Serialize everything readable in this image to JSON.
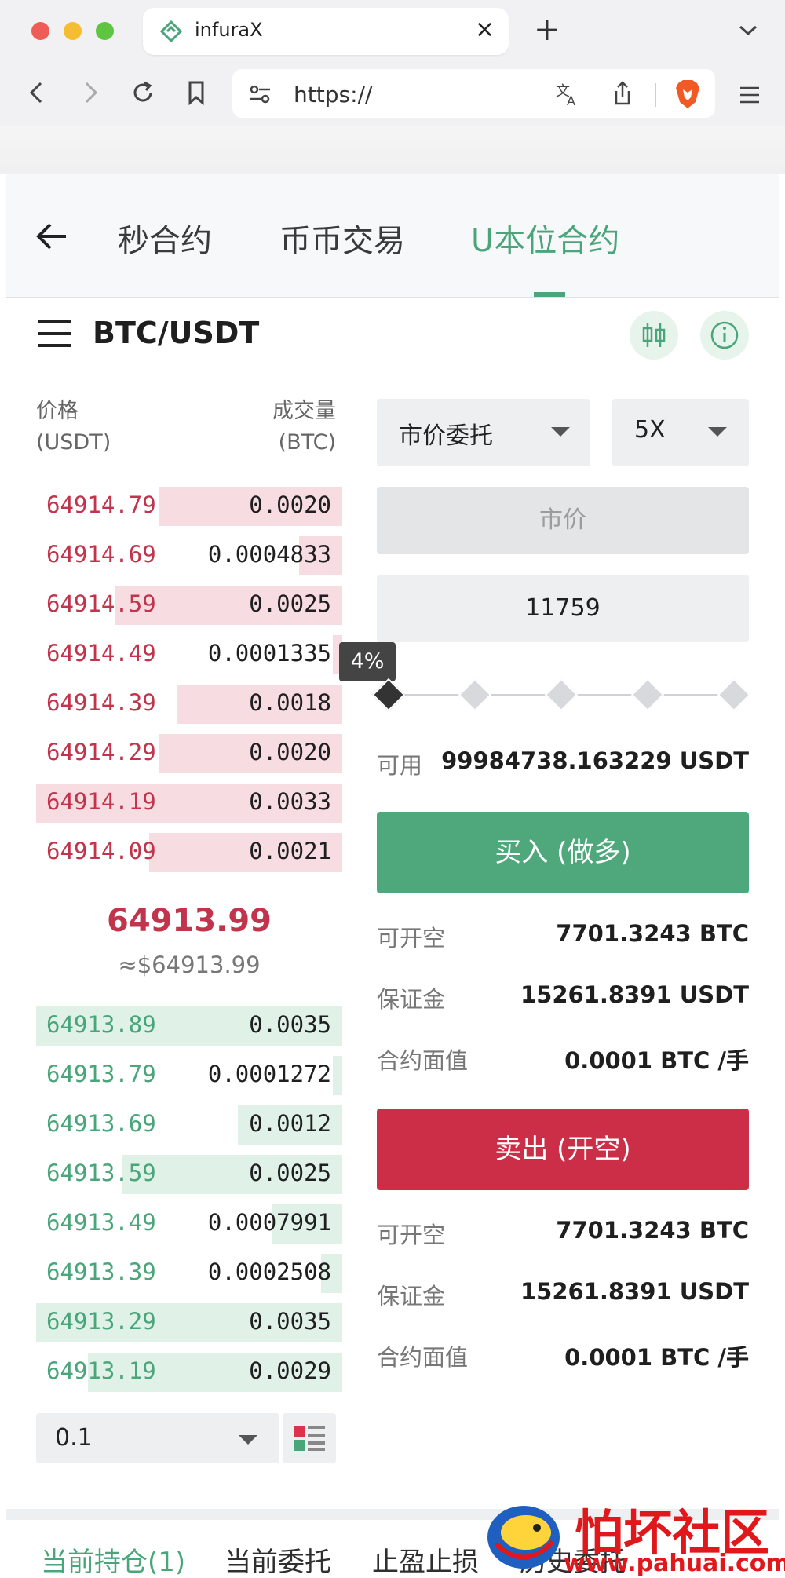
{
  "browser": {
    "tab_title": "infuraX",
    "url": "https://"
  },
  "nav": {
    "tabs": [
      "秒合约",
      "币币交易",
      "U本位合约"
    ],
    "active_tab": "U本位合约"
  },
  "symbol": "BTC/USDT",
  "orderbook": {
    "price_header": "价格",
    "price_unit": "(USDT)",
    "qty_header": "成交量",
    "qty_unit": "(BTC)",
    "asks": [
      {
        "price": "64914.79",
        "qty": "0.0020",
        "depth": 0.6
      },
      {
        "price": "64914.69",
        "qty": "0.0004833",
        "depth": 0.14
      },
      {
        "price": "64914.59",
        "qty": "0.0025",
        "depth": 0.74
      },
      {
        "price": "64914.49",
        "qty": "0.0001335",
        "depth": 0.03
      },
      {
        "price": "64914.39",
        "qty": "0.0018",
        "depth": 0.54
      },
      {
        "price": "64914.29",
        "qty": "0.0020",
        "depth": 0.6
      },
      {
        "price": "64914.19",
        "qty": "0.0033",
        "depth": 1.0
      },
      {
        "price": "64914.09",
        "qty": "0.0021",
        "depth": 0.63
      }
    ],
    "mid_price": "64913.99",
    "mid_usd": "≈$64913.99",
    "bids": [
      {
        "price": "64913.89",
        "qty": "0.0035",
        "depth": 1.0
      },
      {
        "price": "64913.79",
        "qty": "0.0001272",
        "depth": 0.03
      },
      {
        "price": "64913.69",
        "qty": "0.0012",
        "depth": 0.34
      },
      {
        "price": "64913.59",
        "qty": "0.0025",
        "depth": 0.72
      },
      {
        "price": "64913.49",
        "qty": "0.0007991",
        "depth": 0.23
      },
      {
        "price": "64913.39",
        "qty": "0.0002508",
        "depth": 0.07
      },
      {
        "price": "64913.29",
        "qty": "0.0035",
        "depth": 1.0
      },
      {
        "price": "64913.19",
        "qty": "0.0029",
        "depth": 0.83
      }
    ],
    "depth_value": "0.1"
  },
  "form": {
    "order_type": "市价委托",
    "leverage": "5X",
    "price_placeholder": "市价",
    "amount": "11759",
    "slider_label": "4%",
    "slider_percent": 4,
    "available_label": "可用",
    "available_value": "99984738.163229 USDT",
    "buy_button": "买入 (做多)",
    "buy_info": [
      {
        "label": "可开空",
        "value": "7701.3243 BTC"
      },
      {
        "label": "保证金",
        "value": "15261.8391 USDT"
      },
      {
        "label": "合约面值",
        "value": "0.0001 BTC /手"
      }
    ],
    "sell_button": "卖出 (开空)",
    "sell_info": [
      {
        "label": "可开空",
        "value": "7701.3243 BTC"
      },
      {
        "label": "保证金",
        "value": "15261.8391 USDT"
      },
      {
        "label": "合约面值",
        "value": "0.0001 BTC /手"
      }
    ]
  },
  "bottom_tabs": [
    "当前持仓(1)",
    "当前委托",
    "止盈止损",
    "历史委托"
  ],
  "watermark": {
    "text": "怕坏社区",
    "url": "www.pahuai.com"
  },
  "colors": {
    "accent_green": "#4aa57a",
    "ask_red": "#c1344b",
    "sell_red": "#cc2e48",
    "buy_green": "#4fa87c"
  }
}
